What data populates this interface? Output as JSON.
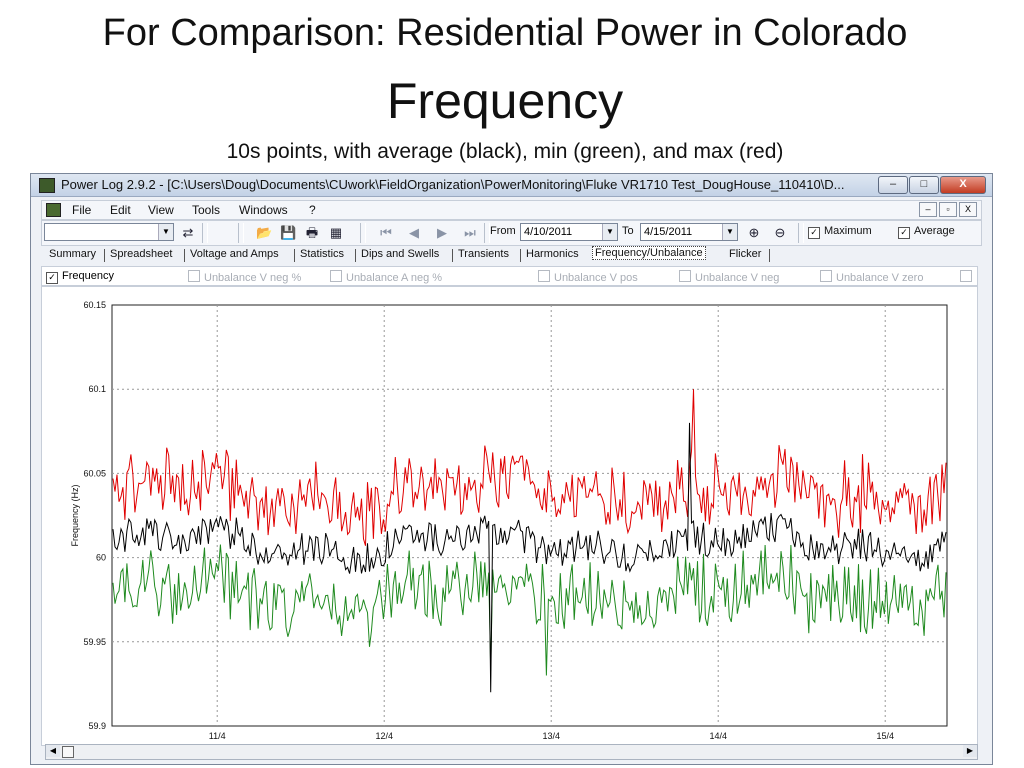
{
  "slide": {
    "title": "For Comparison: Residential Power in Colorado",
    "heading": "Frequency",
    "subtitle": "10s points, with average (black), min (green), and max (red)"
  },
  "window": {
    "title": "Power Log 2.9.2 - [C:\\Users\\Doug\\Documents\\CUwork\\FieldOrganization\\PowerMonitoring\\Fluke VR1710 Test_DougHouse_110410\\D...",
    "buttons": {
      "minimize": "–",
      "maximize": "□",
      "close": "X"
    }
  },
  "menu": [
    "File",
    "Edit",
    "View",
    "Tools",
    "Windows",
    "?"
  ],
  "mdi_buttons": [
    "–",
    "▫",
    "X"
  ],
  "toolbar": {
    "from_label": "From",
    "from_value": "4/10/2011",
    "to_label": "To",
    "to_value": "4/15/2011",
    "maximum_label": "Maximum",
    "maximum_checked": true,
    "average_label": "Average",
    "average_checked": true
  },
  "tabs": [
    {
      "label": "Summary"
    },
    {
      "label": "Spreadsheet"
    },
    {
      "label": "Voltage and Amps"
    },
    {
      "label": "Statistics"
    },
    {
      "label": "Dips and Swells"
    },
    {
      "label": "Transients"
    },
    {
      "label": "Harmonics"
    },
    {
      "label": "Frequency/Unbalance",
      "active": true
    },
    {
      "label": "Flicker"
    }
  ],
  "options": [
    {
      "label": "Frequency",
      "checked": true,
      "enabled": true
    },
    {
      "label": "Unbalance V neg %",
      "checked": false,
      "enabled": false
    },
    {
      "label": "Unbalance A neg %",
      "checked": false,
      "enabled": false
    },
    {
      "label": "Unbalance V pos",
      "checked": false,
      "enabled": false
    },
    {
      "label": "Unbalance V neg",
      "checked": false,
      "enabled": false
    },
    {
      "label": "Unbalance V zero",
      "checked": false,
      "enabled": false
    }
  ],
  "chart_data": {
    "type": "line",
    "title": "",
    "xlabel": "",
    "ylabel": "Frequency (Hz)",
    "ylim": [
      59.9,
      60.15
    ],
    "y_ticks": [
      "60.15",
      "60.1",
      "60.05",
      "60",
      "59.95",
      "59.9"
    ],
    "x_ticks": [
      "11/4",
      "12/4",
      "13/4",
      "14/4",
      "15/4"
    ],
    "grid": true,
    "series": [
      {
        "color": "#e00000",
        "typical_range": [
          60.01,
          60.06
        ],
        "peak": 60.1
      },
      {
        "color": "#000000",
        "typical_range": [
          59.99,
          60.03
        ],
        "min": 59.92
      },
      {
        "color": "#1f8a1f",
        "typical_range": [
          59.96,
          60.01
        ],
        "min": 59.93
      }
    ]
  }
}
